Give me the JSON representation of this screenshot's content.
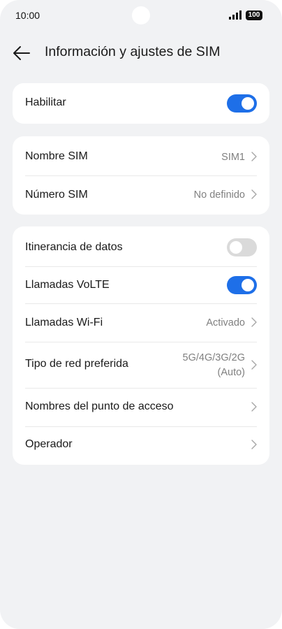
{
  "status_bar": {
    "time": "10:00",
    "battery": "100",
    "icons": [
      "signal-icon",
      "battery-icon"
    ]
  },
  "header": {
    "title": "Información y ajustes de SIM",
    "back_icon": "arrow-left-icon"
  },
  "group1": {
    "enable": {
      "label": "Habilitar",
      "toggle_on": true
    }
  },
  "group2": {
    "sim_name": {
      "label": "Nombre SIM",
      "value": "SIM1"
    },
    "sim_number": {
      "label": "Número SIM",
      "value": "No definido"
    }
  },
  "group3": {
    "roaming": {
      "label": "Itinerancia de datos",
      "toggle_on": false
    },
    "volte": {
      "label": "Llamadas VoLTE",
      "toggle_on": true
    },
    "wifi_calling": {
      "label": "Llamadas Wi-Fi",
      "value": "Activado"
    },
    "network_type": {
      "label": "Tipo de red preferida",
      "value_line1": "5G/4G/3G/2G",
      "value_line2": "(Auto)"
    },
    "apn": {
      "label": "Nombres del punto de acceso"
    },
    "carrier": {
      "label": "Operador"
    }
  },
  "colors": {
    "accent": "#1e6fe8",
    "background": "#f1f2f4",
    "card": "#ffffff",
    "secondary_text": "#808080"
  }
}
